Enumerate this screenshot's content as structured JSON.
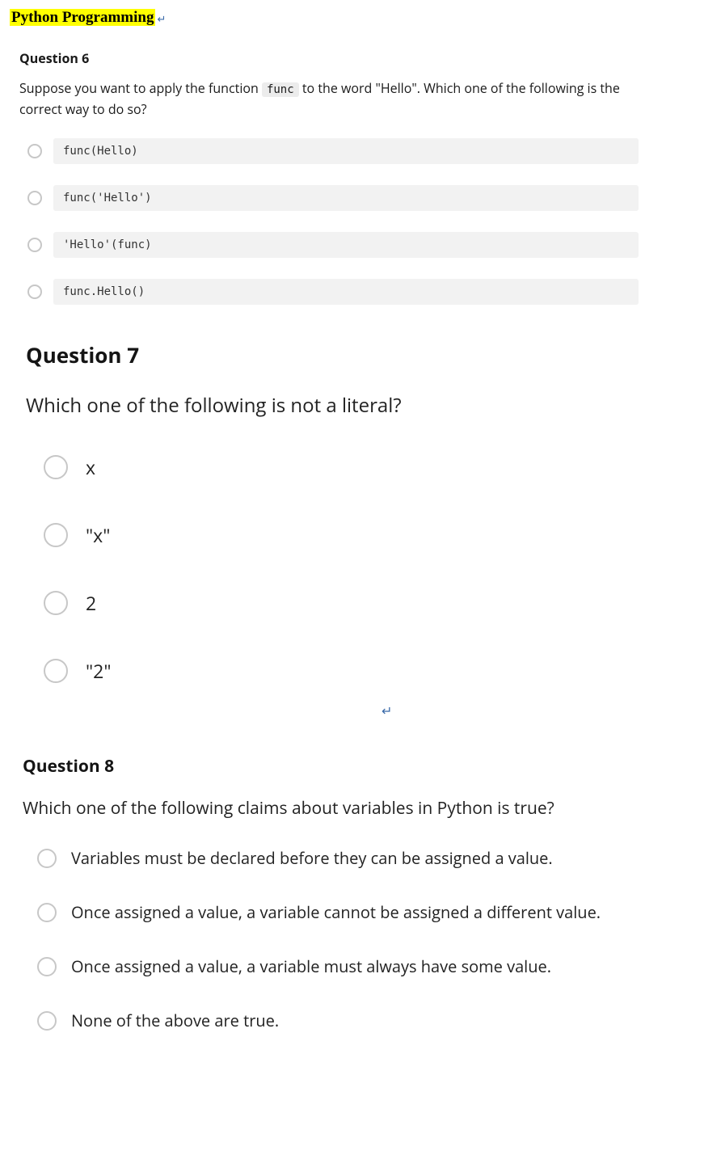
{
  "title": "Python Programming",
  "q6": {
    "heading": "Question 6",
    "prompt_before": "Suppose you want to apply the function ",
    "prompt_code": "func",
    "prompt_after": " to the word \"Hello\". Which one of the following is the correct way to do so?",
    "options": [
      "func(Hello)",
      "func('Hello')",
      "'Hello'(func)",
      "func.Hello()"
    ]
  },
  "q7": {
    "heading": "Question 7",
    "prompt": "Which one of the following is not a literal?",
    "options": [
      "x",
      "\"x\"",
      "2",
      "\"2\""
    ]
  },
  "q8": {
    "heading": "Question 8",
    "prompt": "Which one of the following claims about variables in Python is true?",
    "options": [
      "Variables must be declared before they can be assigned a value.",
      "Once assigned a value, a variable cannot be assigned a different value.",
      "Once assigned a value, a variable must always have some value.",
      "None of the above are true."
    ]
  }
}
